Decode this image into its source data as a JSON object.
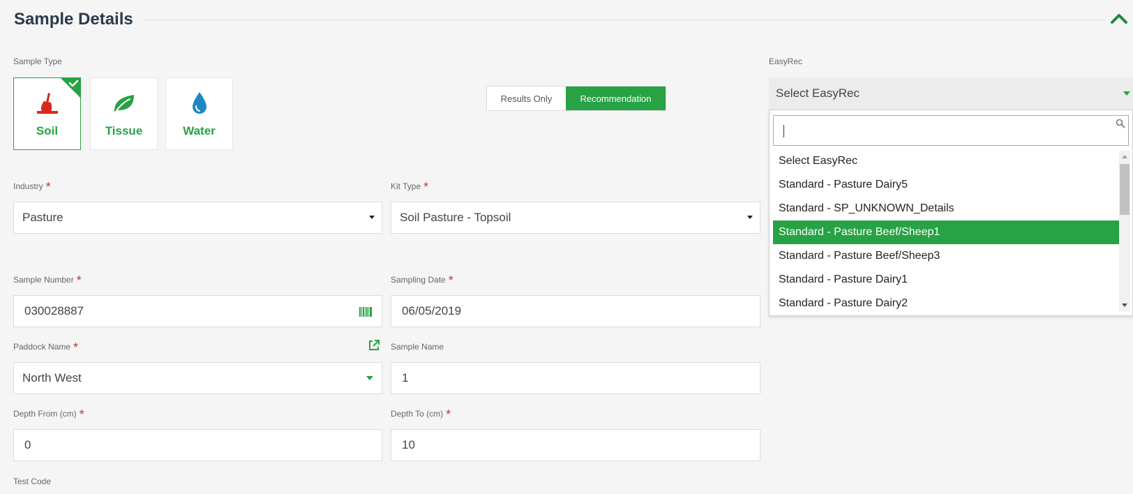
{
  "section": {
    "title": "Sample Details"
  },
  "sample_type": {
    "label": "Sample Type",
    "options": [
      {
        "label": "Soil",
        "selected": true
      },
      {
        "label": "Tissue",
        "selected": false
      },
      {
        "label": "Water",
        "selected": false
      }
    ]
  },
  "mode_toggle": {
    "results_only": "Results Only",
    "recommendation": "Recommendation",
    "active": "Recommendation"
  },
  "easyrec": {
    "label": "EasyRec",
    "selected": "Select EasyRec",
    "search_value": "",
    "options": [
      "Select EasyRec",
      "Standard - Pasture Dairy5",
      "Standard - SP_UNKNOWN_Details",
      "Standard - Pasture Beef/Sheep1",
      "Standard - Pasture Beef/Sheep3",
      "Standard - Pasture Dairy1",
      "Standard - Pasture Dairy2"
    ],
    "highlighted": "Standard - Pasture Beef/Sheep1"
  },
  "form": {
    "industry": {
      "label": "Industry",
      "value": "Pasture"
    },
    "kit_type": {
      "label": "Kit Type",
      "value": "Soil Pasture - Topsoil"
    },
    "sample_number": {
      "label": "Sample Number",
      "value": "030028887"
    },
    "sampling_date": {
      "label": "Sampling Date",
      "value": "06/05/2019"
    },
    "paddock_name": {
      "label": "Paddock Name",
      "value": "North West"
    },
    "sample_name": {
      "label": "Sample Name",
      "value": "1"
    },
    "depth_from": {
      "label": "Depth From (cm)",
      "value": "0"
    },
    "depth_to": {
      "label": "Depth To (cm)",
      "value": "10"
    },
    "test_code": {
      "label": "Test Code"
    }
  },
  "required_marker": "*",
  "colors": {
    "accent": "#27a244",
    "required": "#c0392b",
    "soil_icon": "#d42a1f",
    "water_icon": "#1f86c7",
    "title": "#2a3b4c"
  }
}
